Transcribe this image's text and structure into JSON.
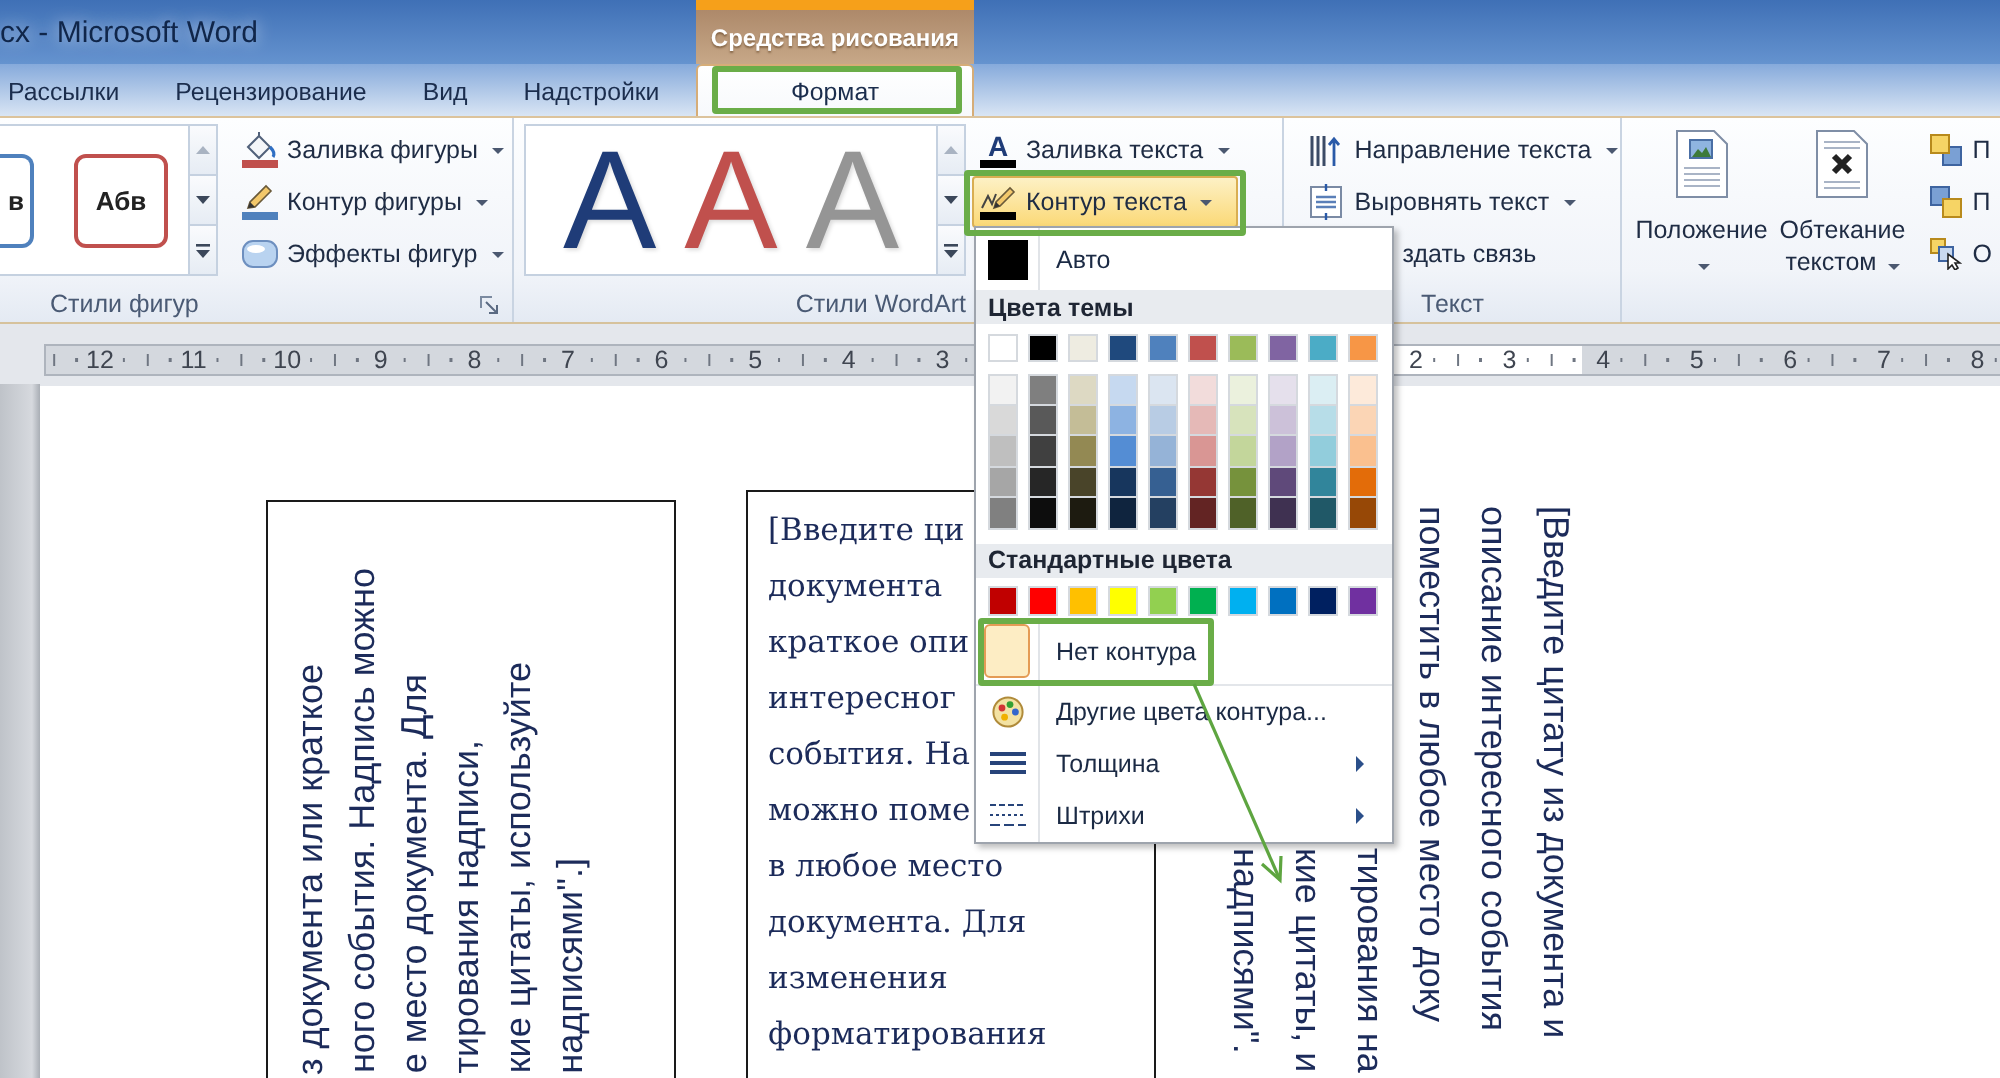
{
  "window": {
    "title": "cx - Microsoft Word"
  },
  "contextual_tab_group": {
    "label": "Средства рисования"
  },
  "tabs": [
    {
      "label": "Рассылки",
      "kind": "standard",
      "selected": false,
      "highlighted": false
    },
    {
      "label": "Рецензирование",
      "kind": "standard",
      "selected": false,
      "highlighted": false
    },
    {
      "label": "Вид",
      "kind": "standard",
      "selected": false,
      "highlighted": false
    },
    {
      "label": "Надстройки",
      "kind": "standard",
      "selected": false,
      "highlighted": false
    },
    {
      "label": "Формат",
      "kind": "contextual",
      "selected": true,
      "highlighted": true
    }
  ],
  "ribbon": {
    "shape_styles": {
      "label": "Стили фигур",
      "gallery": [
        {
          "label": "в",
          "color": "#4f81bd"
        },
        {
          "label": "Абв",
          "color": "#c0504d"
        }
      ],
      "commands": [
        {
          "label": "Заливка фигуры",
          "kind": "fill",
          "color": "#c0504d"
        },
        {
          "label": "Контур фигуры",
          "kind": "outline",
          "color": "#4f81bd"
        },
        {
          "label": "Эффекты фигур",
          "kind": "effects"
        }
      ]
    },
    "wordart_styles": {
      "label": "Стили WordArt",
      "gallery": [
        {
          "letter": "A",
          "color": "#1f3c78"
        },
        {
          "letter": "A",
          "color": "#c0504d"
        },
        {
          "letter": "A",
          "color": "#959595"
        }
      ],
      "commands": [
        {
          "label": "Заливка текста",
          "kind": "fill",
          "icon_letter": "A",
          "color": "#000000",
          "expanded": false,
          "highlighted": false
        },
        {
          "label": "Контур текста",
          "kind": "outline",
          "color": "#000000",
          "expanded": true,
          "highlighted": true
        }
      ]
    },
    "text": {
      "label": "Текст",
      "commands": [
        {
          "label": "Направление текста",
          "kind": "direction",
          "menu": true
        },
        {
          "label": "Выровнять текст",
          "kind": "align",
          "menu": true
        },
        {
          "label": "здать связь",
          "kind": "link",
          "menu": false
        }
      ]
    },
    "arrange": {
      "large_commands": [
        {
          "label": "Положение",
          "kind": "position"
        },
        {
          "label": "Обтекание текстом",
          "kind": "wrap"
        }
      ],
      "small_commands": [
        {
          "label": "П",
          "kind": "forward"
        },
        {
          "label": "П",
          "kind": "backward"
        },
        {
          "label": "О",
          "kind": "pane"
        }
      ]
    }
  },
  "ruler": {
    "left_numbers": [
      "12",
      "11",
      "10",
      "9",
      "8",
      "7",
      "6",
      "5",
      "4",
      "3"
    ],
    "right_numbers": [
      "2",
      "3",
      "4",
      "5",
      "6",
      "7",
      "8"
    ]
  },
  "text_boxes": [
    {
      "kind": "rotated_up",
      "bordered": true,
      "lines": [
        "з документа или краткое",
        "ного события. Надпись можно",
        "е место документа. Для",
        "тирования надписи,",
        "кие цитаты, используйте",
        "надписями\".]"
      ]
    },
    {
      "kind": "horizontal",
      "bordered": true,
      "lines": [
        "[Введите ци",
        "документа",
        "краткое опи",
        "интересног",
        "события. На",
        "можно поме",
        "в любое место",
        "документа. Для",
        "изменения",
        "форматирования"
      ]
    },
    {
      "kind": "rotated_down",
      "lines": [
        {
          "text": "[Введите цитату из документа и",
          "covered": false
        },
        {
          "text": "описание интересного события",
          "covered": false
        },
        {
          "text": "поместить в любое место доку",
          "covered": false
        },
        {
          "text": "тирования на",
          "covered": true
        },
        {
          "text": "кие цитаты, и",
          "covered": true
        },
        {
          "text": "надписями\".",
          "covered": true
        }
      ]
    }
  ],
  "text_outline_menu": {
    "auto": {
      "label": "Авто",
      "color": "#000000"
    },
    "theme_header": "Цвета темы",
    "theme_colors": [
      {
        "color": "#ffffff",
        "shades": [
          {
            "color": "#f2f2f2"
          },
          {
            "color": "#d9d9d9"
          },
          {
            "color": "#bfbfbf"
          },
          {
            "color": "#a6a6a6"
          },
          {
            "color": "#808080"
          }
        ]
      },
      {
        "color": "#000000",
        "shades": [
          {
            "color": "#7f7f7f"
          },
          {
            "color": "#595959"
          },
          {
            "color": "#404040"
          },
          {
            "color": "#262626"
          },
          {
            "color": "#0d0d0d"
          }
        ]
      },
      {
        "color": "#eeece1",
        "shades": [
          {
            "color": "#ddd9c3"
          },
          {
            "color": "#c4bd97"
          },
          {
            "color": "#938953"
          },
          {
            "color": "#494429"
          },
          {
            "color": "#1d1b10"
          }
        ]
      },
      {
        "color": "#1f497d",
        "shades": [
          {
            "color": "#c6d9f0"
          },
          {
            "color": "#8db3e2"
          },
          {
            "color": "#548dd4"
          },
          {
            "color": "#17365d"
          },
          {
            "color": "#0f243e"
          }
        ]
      },
      {
        "color": "#4f81bd",
        "shades": [
          {
            "color": "#dbe5f1"
          },
          {
            "color": "#b8cce4"
          },
          {
            "color": "#95b3d7"
          },
          {
            "color": "#366092"
          },
          {
            "color": "#244061"
          }
        ]
      },
      {
        "color": "#c0504d",
        "shades": [
          {
            "color": "#f2dcdb"
          },
          {
            "color": "#e5b9b7"
          },
          {
            "color": "#d99694"
          },
          {
            "color": "#953734"
          },
          {
            "color": "#632423"
          }
        ]
      },
      {
        "color": "#9bbb59",
        "shades": [
          {
            "color": "#ebf1dd"
          },
          {
            "color": "#d7e3bc"
          },
          {
            "color": "#c3d69b"
          },
          {
            "color": "#76923c"
          },
          {
            "color": "#4f6128"
          }
        ]
      },
      {
        "color": "#8064a2",
        "shades": [
          {
            "color": "#e5e0ec"
          },
          {
            "color": "#ccc1d9"
          },
          {
            "color": "#b2a2c7"
          },
          {
            "color": "#5f497a"
          },
          {
            "color": "#3f3151"
          }
        ]
      },
      {
        "color": "#4bacc6",
        "shades": [
          {
            "color": "#dbeef3"
          },
          {
            "color": "#b7dde8"
          },
          {
            "color": "#92cddc"
          },
          {
            "color": "#31859b"
          },
          {
            "color": "#205867"
          }
        ]
      },
      {
        "color": "#f79646",
        "shades": [
          {
            "color": "#fdeada"
          },
          {
            "color": "#fbd5b5"
          },
          {
            "color": "#fac08f"
          },
          {
            "color": "#e36c09"
          },
          {
            "color": "#974806"
          }
        ]
      }
    ],
    "standard_header": "Стандартные цвета",
    "standard_colors": [
      {
        "color": "#c00000"
      },
      {
        "color": "#ff0000"
      },
      {
        "color": "#ffc000"
      },
      {
        "color": "#ffff00"
      },
      {
        "color": "#92d050"
      },
      {
        "color": "#00b050"
      },
      {
        "color": "#00b0f0"
      },
      {
        "color": "#0070c0"
      },
      {
        "color": "#002060"
      },
      {
        "color": "#7030a0"
      }
    ],
    "items": [
      {
        "label": "Нет контура",
        "kind": "none",
        "selected": true,
        "highlighted": true,
        "submenu": false
      },
      {
        "label": "Другие цвета контура...",
        "kind": "more",
        "selected": false,
        "highlighted": false,
        "submenu": false
      },
      {
        "label": "Толщина",
        "kind": "weight",
        "selected": false,
        "highlighted": false,
        "submenu": true
      },
      {
        "label": "Штрихи",
        "kind": "dashes",
        "selected": false,
        "highlighted": false,
        "submenu": true
      }
    ]
  }
}
